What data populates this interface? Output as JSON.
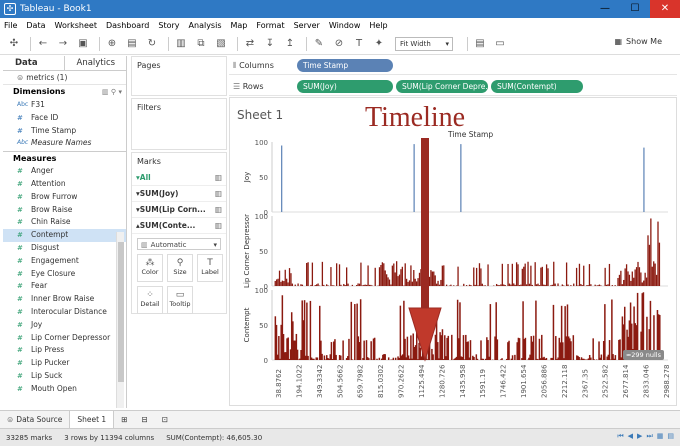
{
  "window": {
    "title": "Tableau - Book1",
    "minimize": "—",
    "maximize": "☐",
    "close": "✕"
  },
  "menu": [
    "File",
    "Data",
    "Worksheet",
    "Dashboard",
    "Story",
    "Analysis",
    "Map",
    "Format",
    "Server",
    "Window",
    "Help"
  ],
  "toolbar": {
    "fit": "Fit Width",
    "show_me": "Show Me"
  },
  "left": {
    "tab_data": "Data",
    "tab_analytics": "Analytics",
    "datasource": "metrics (1)",
    "dimensions_title": "Dimensions",
    "dimensions": [
      {
        "type": "Abc",
        "name": "F31",
        "italic": false
      },
      {
        "type": "#",
        "name": "Face ID",
        "italic": false
      },
      {
        "type": "#",
        "name": "Time Stamp",
        "italic": false
      },
      {
        "type": "Abc",
        "name": "Measure Names",
        "italic": true
      }
    ],
    "measures_title": "Measures",
    "measures": [
      "Anger",
      "Attention",
      "Brow Furrow",
      "Brow Raise",
      "Chin Raise",
      "Contempt",
      "Disgust",
      "Engagement",
      "Eye Closure",
      "Fear",
      "Inner Brow Raise",
      "Interocular Distance",
      "Joy",
      "Lip Corner Depressor",
      "Lip Press",
      "Lip Pucker",
      "Lip Suck",
      "Mouth Open"
    ],
    "highlighted": "Contempt"
  },
  "pages_title": "Pages",
  "filters_title": "Filters",
  "marks": {
    "title": "Marks",
    "rows": [
      "All",
      "SUM(Joy)",
      "SUM(Lip Corn...",
      "SUM(Conte..."
    ],
    "type": "Automatic",
    "buttons": [
      {
        "label": "Color",
        "icon": "color-icon"
      },
      {
        "label": "Size",
        "icon": "size-icon"
      },
      {
        "label": "Label",
        "icon": "label-icon"
      },
      {
        "label": "Detail",
        "icon": "detail-icon"
      },
      {
        "label": "Tooltip",
        "icon": "tooltip-icon"
      }
    ]
  },
  "shelves": {
    "columns_label": "Columns",
    "rows_label": "Rows",
    "columns": [
      "Time Stamp"
    ],
    "rows": [
      "SUM(Joy)",
      "SUM(Lip Corner Depre..",
      "SUM(Contempt)"
    ]
  },
  "sheet": {
    "title": "Sheet 1",
    "annotation": "Timeline",
    "nulls_badge": "≈299 nulls"
  },
  "chart_data": {
    "type": "bar",
    "title": "",
    "xlabel": "Time Stamp",
    "x_ticks": [
      "38.8762",
      "194.1022",
      "349.3342",
      "504.5662",
      "659.7982",
      "815.0302",
      "970.2622",
      "1125.494",
      "1280.726",
      "1435.958",
      "1591.19",
      "1746.422",
      "1901.654",
      "2056.886",
      "2212.118",
      "2367.35",
      "2522.582",
      "2677.814",
      "2833.046",
      "2988.278"
    ],
    "panes": [
      {
        "name": "Joy",
        "ylim": [
          0,
          100
        ],
        "yticks": [
          0,
          50,
          100
        ],
        "bars": [
          {
            "x": 70,
            "y": 95
          },
          {
            "x": 1090,
            "y": 97
          },
          {
            "x": 1180,
            "y": 88
          },
          {
            "x": 1450,
            "y": 97
          },
          {
            "x": 2860,
            "y": 92
          }
        ]
      },
      {
        "name": "Lip Corner Depressor",
        "ylim": [
          0,
          100
        ],
        "yticks": [
          0,
          50,
          100
        ],
        "profile": "sparse"
      },
      {
        "name": "Contempt",
        "ylim": [
          0,
          100
        ],
        "yticks": [
          0,
          50,
          100
        ],
        "profile": "dense"
      }
    ]
  },
  "bottom": {
    "datasource_tab": "Data Source",
    "sheet_tab": "Sheet 1"
  },
  "status": {
    "marks": "33285 marks",
    "rows": "3 rows by 11394 columns",
    "sum": "SUM(Contempt): 46,605.30"
  }
}
